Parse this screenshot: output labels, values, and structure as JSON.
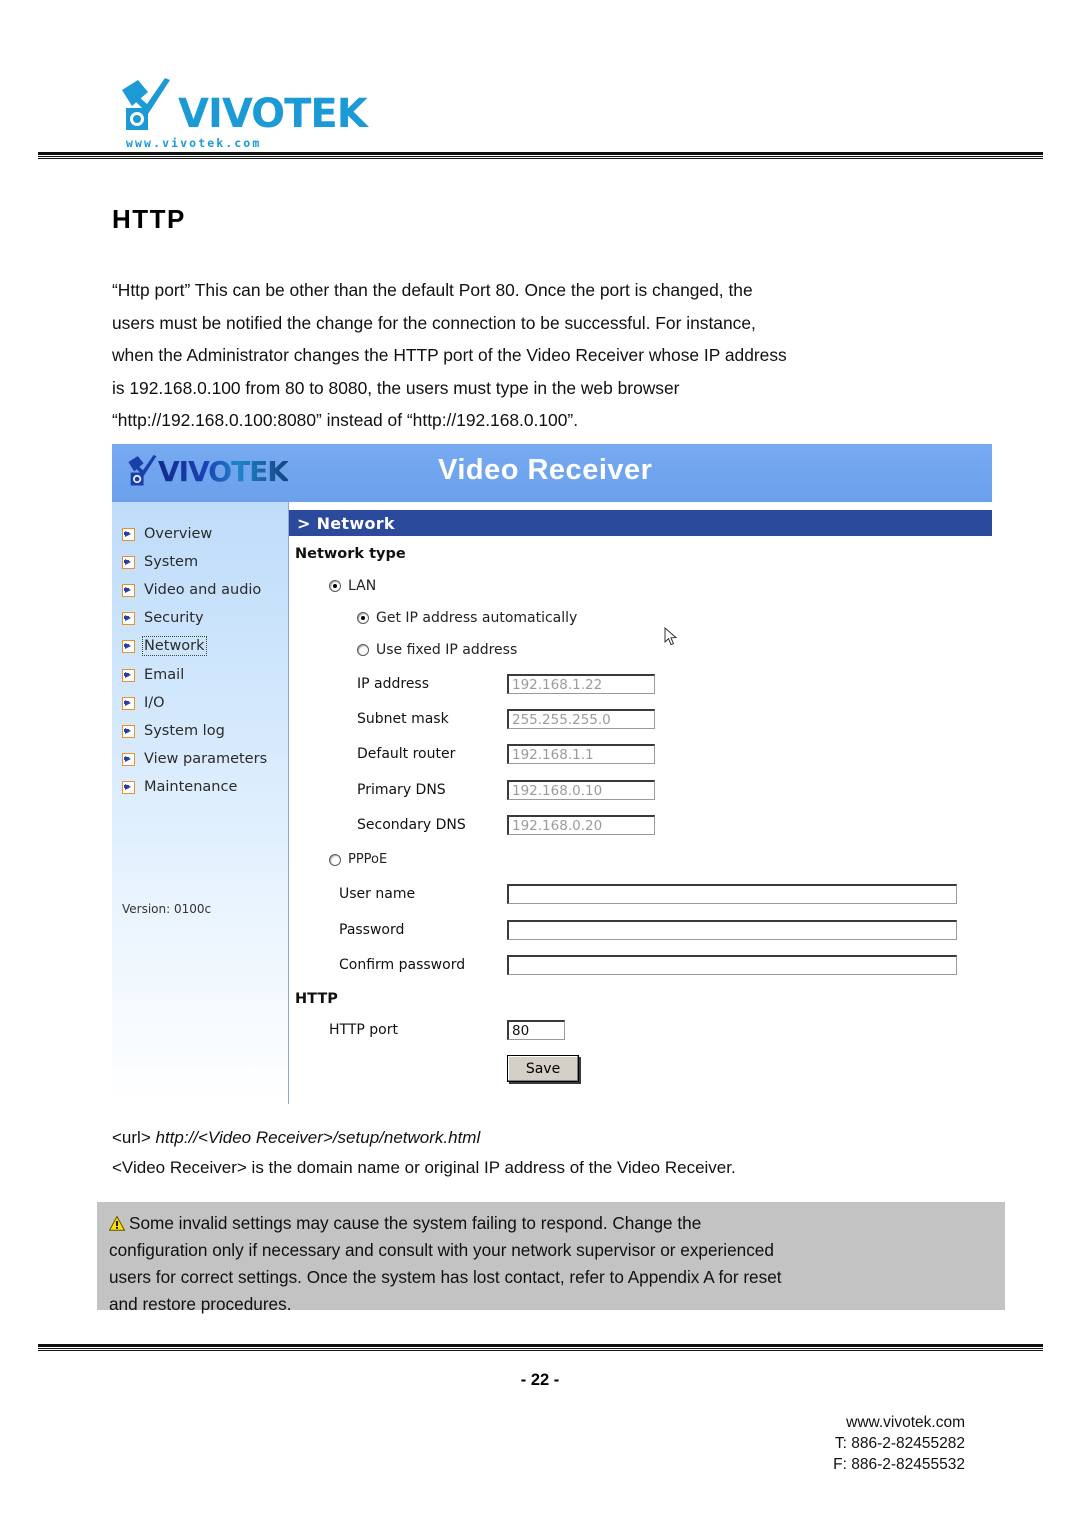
{
  "header": {
    "brand": "VIVOTEK",
    "brand_url": "www.vivotek.com",
    "logo_icon": "vivotek-camera-checkmark-logo"
  },
  "section": {
    "title": "HTTP",
    "paragraph_lines": [
      "“Http port” This can be other than the default Port 80. Once the port is changed, the",
      "users must be notified the change for the connection to be successful. For instance,",
      "when the Administrator changes the HTTP port of the Video Receiver whose IP address",
      "is 192.168.0.100 from 80 to 8080, the users must type in the web browser",
      "“http://192.168.0.100:8080” instead of “http://192.168.0.100”."
    ]
  },
  "screenshot": {
    "banner": {
      "brand": "VIVOTEK",
      "title": "Video Receiver"
    },
    "sidebar": {
      "items": [
        {
          "label": "Overview",
          "active": false
        },
        {
          "label": "System",
          "active": false
        },
        {
          "label": "Video and audio",
          "active": false
        },
        {
          "label": "Security",
          "active": false
        },
        {
          "label": "Network",
          "active": true
        },
        {
          "label": "Email",
          "active": false
        },
        {
          "label": "I/O",
          "active": false
        },
        {
          "label": "System log",
          "active": false
        },
        {
          "label": "View parameters",
          "active": false
        },
        {
          "label": "Maintenance",
          "active": false
        }
      ],
      "version": "Version: 0100c"
    },
    "breadcrumb": "> Network",
    "network_type": {
      "heading": "Network type",
      "lan_label": "LAN",
      "lan_selected": true,
      "dhcp_label": "Get IP address automatically",
      "dhcp_selected": true,
      "fixed_label": "Use fixed IP address",
      "fixed_selected": false,
      "fields": [
        {
          "label": "IP address",
          "value": "192.168.1.22"
        },
        {
          "label": "Subnet mask",
          "value": "255.255.255.0"
        },
        {
          "label": "Default router",
          "value": "192.168.1.1"
        },
        {
          "label": "Primary DNS",
          "value": "192.168.0.10"
        },
        {
          "label": "Secondary DNS",
          "value": "192.168.0.20"
        }
      ],
      "pppoe_label": "PPPoE",
      "pppoe_selected": false,
      "pppoe_fields": [
        {
          "label": "User name",
          "value": ""
        },
        {
          "label": "Password",
          "value": ""
        },
        {
          "label": "Confirm password",
          "value": ""
        }
      ]
    },
    "http": {
      "heading": "HTTP",
      "port_label": "HTTP port",
      "port_value": "80"
    },
    "save_label": "Save"
  },
  "caption": {
    "url_prefix": "<url>",
    "url_value": "http://<Video Receiver>/setup/network.html",
    "description": "<Video Receiver> is the domain name or original IP address of the Video Receiver."
  },
  "note": {
    "icon": "warning-triangle-icon",
    "lines": [
      "Some invalid settings may cause the system failing to respond. Change the",
      "configuration only if necessary and consult with your network supervisor or experienced",
      "users for correct settings. Once the system has lost contact, refer to Appendix A for reset",
      "and restore procedures."
    ]
  },
  "footer": {
    "page_number": "- 22 -",
    "website": "www.vivotek.com",
    "phone": "T: 886-2-82455282",
    "fax": "F: 886-2-82455532"
  },
  "colors": {
    "brand_blue": "#1C9AD6",
    "banner_blue": "#6FA4EE",
    "crumb_navy": "#2C4A9C",
    "nav_icon_orange": "#E8922B",
    "note_gray": "#C3C3C3",
    "warning_yellow": "#FFDD00"
  }
}
